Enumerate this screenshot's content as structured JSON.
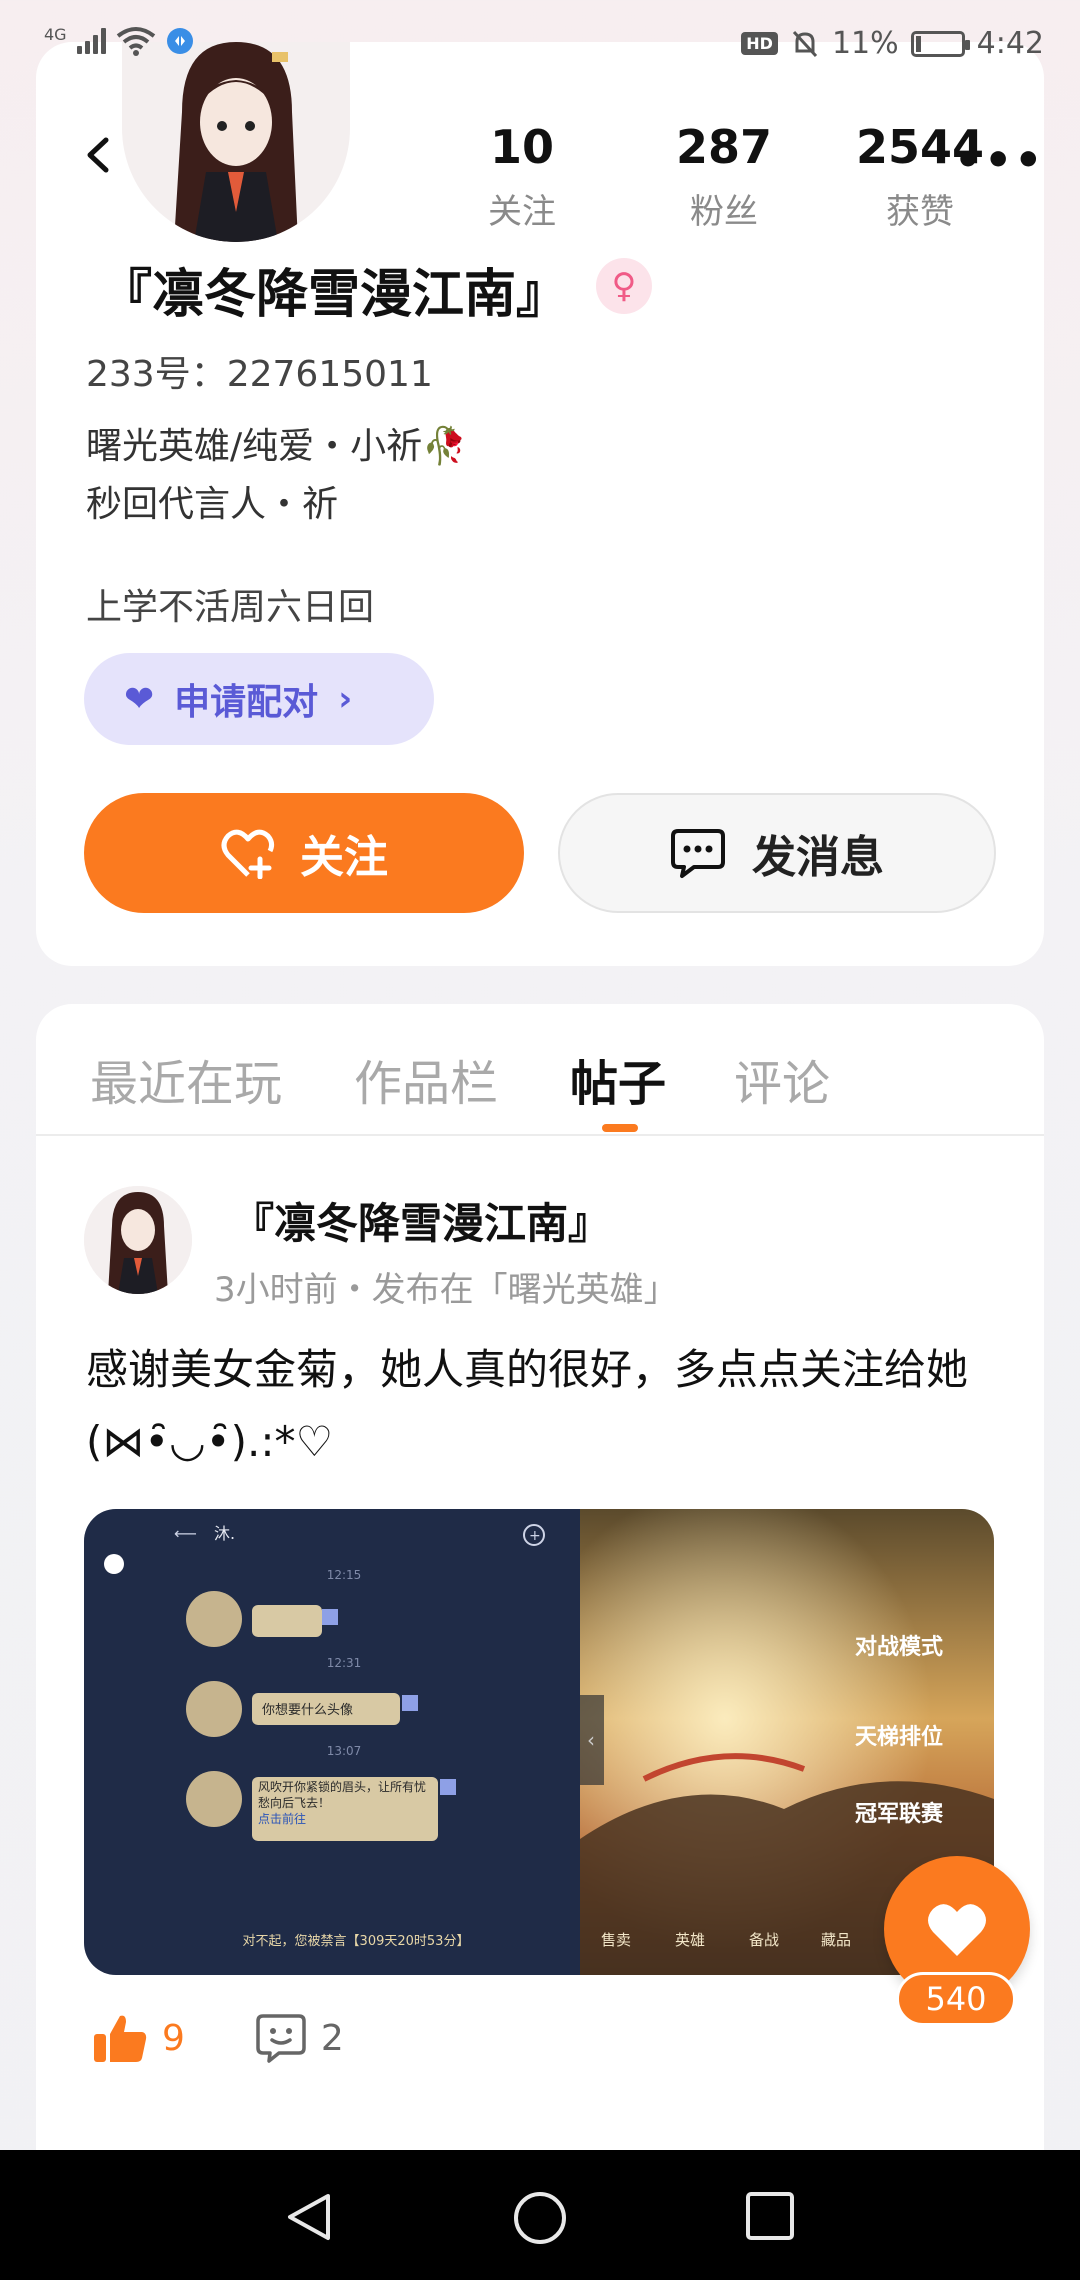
{
  "status_bar": {
    "network": "4G",
    "hd": "HD",
    "battery": "11%",
    "battery_level": 0.11,
    "time": "4:42"
  },
  "profile": {
    "stats": [
      {
        "value": "10",
        "label": "关注"
      },
      {
        "value": "287",
        "label": "粉丝"
      },
      {
        "value": "2544",
        "label": "获赞"
      }
    ],
    "name": "『凛冬降雪漫江南』",
    "gender_symbol": "♀",
    "uid": "233号：227615011",
    "bio_lines": [
      "曙光英雄/纯爱・小祈🥀",
      "秒回代言人・祈"
    ],
    "note": "上学不活周六日回",
    "pair_button": "申请配对",
    "follow_button": "关注",
    "message_button": "发消息"
  },
  "tabs": [
    {
      "label": "最近在玩",
      "active": false
    },
    {
      "label": "作品栏",
      "active": false
    },
    {
      "label": "帖子",
      "active": true
    },
    {
      "label": "评论",
      "active": false
    }
  ],
  "post": {
    "author": "『凛冬降雪漫江南』",
    "meta": "3小时前・发布在「曙光英雄」",
    "text": "感谢美女金菊，她人真的很好，多点点关注给她(⋈•̑◡•̑).:*♡",
    "image": {
      "chat_header": "沐.",
      "times": [
        "12:15",
        "12:31",
        "13:07"
      ],
      "bubble_2": "你想要什么头像",
      "bubble_3": "风吹开你紧锁的眉头，让所有忧愁向后飞去！",
      "bubble_3_link": "点击前往",
      "ban_notice": "对不起，您被禁言【309天20时53分】",
      "menu_1": "对战模式",
      "menu_2": "天梯排位",
      "menu_3": "冠军联赛",
      "bottom_tabs": [
        "售卖",
        "英雄",
        "备战",
        "藏品"
      ]
    },
    "likes": "9",
    "comments": "2"
  },
  "fab": {
    "count": "540"
  },
  "colors": {
    "accent": "#fb7a1f",
    "pair_bg": "#e5e3fb",
    "pair_text": "#5a5ad6"
  }
}
